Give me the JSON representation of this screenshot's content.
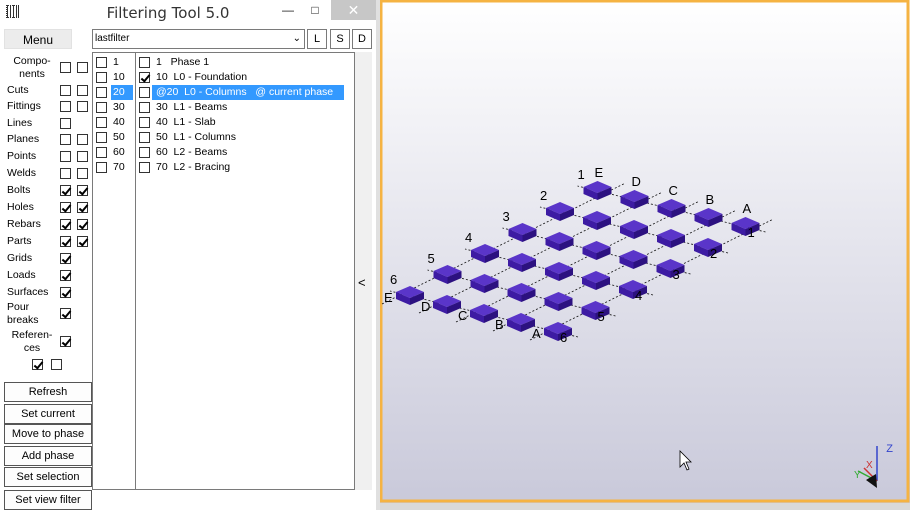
{
  "window": {
    "title": "Filtering Tool 5.0",
    "minimize": "—",
    "maximize": "□",
    "close": "✕"
  },
  "menu_label": "Menu",
  "filter": {
    "value": "lastfilter",
    "arrow": "⌄"
  },
  "side_buttons": [
    "L",
    "S",
    "D"
  ],
  "categories": [
    {
      "label": "Compo-\nnents",
      "checks": [
        false,
        false
      ]
    },
    {
      "label": "Cuts",
      "checks": [
        false,
        false
      ]
    },
    {
      "label": "Fittings",
      "checks": [
        false,
        false
      ]
    },
    {
      "label": "Lines",
      "checks": [
        false
      ]
    },
    {
      "label": "Planes",
      "checks": [
        false,
        false
      ]
    },
    {
      "label": "Points",
      "checks": [
        false,
        false
      ]
    },
    {
      "label": "Welds",
      "checks": [
        false,
        false
      ]
    },
    {
      "label": "Bolts",
      "checks": [
        true,
        true
      ]
    },
    {
      "label": "Holes",
      "checks": [
        true,
        true
      ]
    },
    {
      "label": "Rebars",
      "checks": [
        true,
        true
      ]
    },
    {
      "label": "Parts",
      "checks": [
        true,
        true
      ]
    },
    {
      "label": "Grids",
      "checks": [
        true
      ]
    },
    {
      "label": "Loads",
      "checks": [
        true
      ]
    },
    {
      "label": "Surfaces",
      "checks": [
        true
      ]
    },
    {
      "label": "Pour\nbreaks",
      "checks": [
        true
      ]
    },
    {
      "label": "Referen-\nces",
      "checks": [
        true
      ]
    }
  ],
  "bottom_checks": [
    true,
    false
  ],
  "actions": [
    "Refresh",
    "Set current",
    "Move to phase",
    "Add phase",
    "Set selection",
    "Set view filter"
  ],
  "phase_numbers": [
    {
      "num": "1",
      "checked": false,
      "selected": false
    },
    {
      "num": "10",
      "checked": false,
      "selected": false
    },
    {
      "num": "20",
      "checked": false,
      "selected": true
    },
    {
      "num": "30",
      "checked": false,
      "selected": false
    },
    {
      "num": "40",
      "checked": false,
      "selected": false
    },
    {
      "num": "50",
      "checked": false,
      "selected": false
    },
    {
      "num": "60",
      "checked": false,
      "selected": false
    },
    {
      "num": "70",
      "checked": false,
      "selected": false
    }
  ],
  "phases": [
    {
      "text": "1   Phase 1",
      "checked": false,
      "selected": false
    },
    {
      "text": "10  L0 - Foundation",
      "checked": true,
      "selected": false
    },
    {
      "text": "@20  L0 - Columns   @ current phase",
      "checked": false,
      "selected": true
    },
    {
      "text": "30  L1 - Beams",
      "checked": false,
      "selected": false
    },
    {
      "text": "40  L1 - Slab",
      "checked": false,
      "selected": false
    },
    {
      "text": "50  L1 - Columns",
      "checked": false,
      "selected": false
    },
    {
      "text": "60  L2 - Beams",
      "checked": false,
      "selected": false
    },
    {
      "text": "70  L2 - Bracing",
      "checked": false,
      "selected": false
    }
  ],
  "collapse_arrow": "<",
  "model_view": {
    "grid_numbers": [
      "1",
      "2",
      "3",
      "4",
      "5",
      "6"
    ],
    "grid_letters": [
      "A",
      "B",
      "C",
      "D",
      "E"
    ],
    "pad_color": "#3d1ba3",
    "background_top": "#ffffff",
    "background_bottom": "#c9c9da",
    "border_color": "#f5b342",
    "axis_labels": [
      "Z",
      "Y",
      "X"
    ]
  }
}
